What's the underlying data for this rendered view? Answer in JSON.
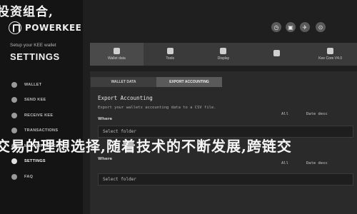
{
  "watermark": {
    "top": "投资组合,",
    "middle": "交易的理想选择,随着技术的不断发展,跨链交"
  },
  "brand": {
    "name": "POWERKEE"
  },
  "sidebar": {
    "subtitle": "Setup your KEE wallet",
    "title": "SETTINGS",
    "items": [
      {
        "label": "WALLET"
      },
      {
        "label": "SEND KEE"
      },
      {
        "label": "RECEIVE KEE"
      },
      {
        "label": "TRANSACTIONS"
      },
      {
        "label": "MASTER NODES"
      },
      {
        "label": "SETTINGS"
      },
      {
        "label": "FAQ"
      }
    ]
  },
  "controls": [
    "◷",
    "▣",
    "✈",
    "⊙"
  ],
  "tabs": [
    {
      "label": "Wallet data"
    },
    {
      "label": "Tools"
    },
    {
      "label": "Display"
    },
    {
      "label": ""
    },
    {
      "label": "Kee Core V4.0"
    }
  ],
  "subtabs": [
    {
      "label": "WALLET DATA"
    },
    {
      "label": "EXPORT ACCOUNTING"
    }
  ],
  "export": {
    "heading": "Export Accounting",
    "desc": "Export your wallets accounting data to a CSV file.",
    "where_label": "Where",
    "all_1": "All",
    "date_1": "Date desc",
    "folder_1": "Select folder",
    "where_label_2": "Where",
    "all_2": "All",
    "date_2": "Date desc",
    "folder_2": "Select folder"
  }
}
